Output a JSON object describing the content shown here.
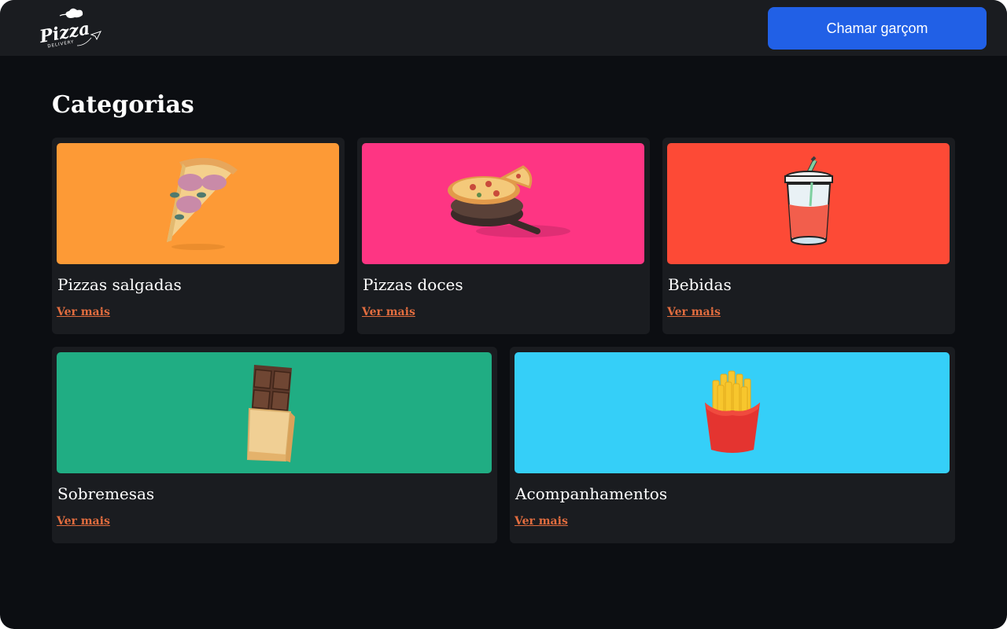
{
  "header": {
    "logo_text": "Pizza",
    "logo_subtext": "DELIVERY",
    "call_waiter_label": "Chamar garçom"
  },
  "page_title": "Categorias",
  "colors": {
    "background": "#0c0e12",
    "surface": "#1a1c20",
    "primary_button": "#2160e6",
    "link": "#e26d3f"
  },
  "categories": [
    {
      "title": "Pizzas salgadas",
      "link_label": "Ver mais",
      "color": "#fd9a36",
      "icon": "pizza-slice-icon"
    },
    {
      "title": "Pizzas doces",
      "link_label": "Ver mais",
      "color": "#fe3583",
      "icon": "whole-pizza-icon"
    },
    {
      "title": "Bebidas",
      "link_label": "Ver mais",
      "color": "#fd4a36",
      "icon": "drink-cup-icon"
    },
    {
      "title": "Sobremesas",
      "link_label": "Ver mais",
      "color": "#20ad83",
      "icon": "chocolate-bar-icon"
    },
    {
      "title": "Acompanhamentos",
      "link_label": "Ver mais",
      "color": "#35cff8",
      "icon": "french-fries-icon"
    }
  ]
}
